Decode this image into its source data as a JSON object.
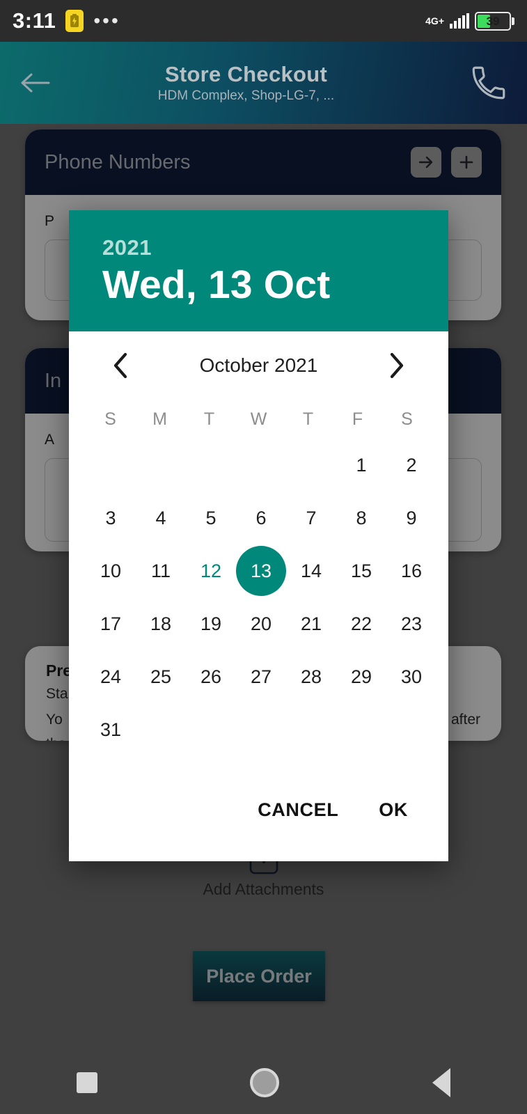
{
  "status_bar": {
    "time": "3:11",
    "battery_saver_icon": "battery-saver-icon",
    "overflow_icon": "more-dots-icon",
    "network_label": "4G+",
    "signal_icon": "signal-bars-icon",
    "battery_percent": "39"
  },
  "app_bar": {
    "back_icon": "arrow-left-icon",
    "title": "Store Checkout",
    "subtitle": "HDM Complex, Shop-LG-7, ...",
    "call_icon": "phone-icon"
  },
  "background": {
    "card_phone": {
      "header_title": "Phone Numbers",
      "forward_icon": "arrow-right-icon",
      "add_icon": "plus-icon",
      "field_label": "P"
    },
    "card_instructions": {
      "header_title": "In",
      "field_label": "A"
    },
    "card_preorder": {
      "title": "Pre",
      "line1": "Sta",
      "line2_left": "Yo",
      "line2_right": "r after",
      "line3": "tha"
    },
    "attachments": {
      "icon": "camera-icon",
      "label": "Add Attachments"
    },
    "place_order_label": "Place Order"
  },
  "date_picker": {
    "year": "2021",
    "selected_date_label": "Wed, 13 Oct",
    "prev_icon": "chevron-left-icon",
    "next_icon": "chevron-right-icon",
    "month_label": "October 2021",
    "weekdays": [
      "S",
      "M",
      "T",
      "W",
      "T",
      "F",
      "S"
    ],
    "leading_blanks": 5,
    "days": [
      1,
      2,
      3,
      4,
      5,
      6,
      7,
      8,
      9,
      10,
      11,
      12,
      13,
      14,
      15,
      16,
      17,
      18,
      19,
      20,
      21,
      22,
      23,
      24,
      25,
      26,
      27,
      28,
      29,
      30,
      31
    ],
    "today": 12,
    "selected": 13,
    "cancel_label": "CANCEL",
    "ok_label": "OK",
    "accent_color": "#00897b"
  },
  "nav_bar": {
    "recents_icon": "square-recents-icon",
    "home_icon": "circle-home-icon",
    "back_icon": "triangle-back-icon"
  }
}
